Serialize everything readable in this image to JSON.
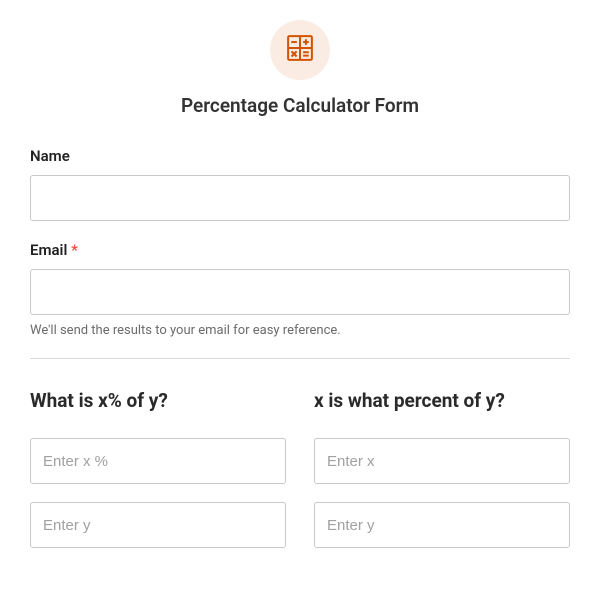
{
  "header": {
    "title": "Percentage Calculator Form",
    "icon": "calculator-icon"
  },
  "fields": {
    "name": {
      "label": "Name",
      "required": false
    },
    "email": {
      "label": "Email",
      "required": true,
      "required_mark": "*",
      "helper": "We'll send the results to your email for easy reference."
    }
  },
  "calculators": {
    "percent_of": {
      "title": "What is x% of y?",
      "x_placeholder": "Enter x %",
      "y_placeholder": "Enter y"
    },
    "what_percent": {
      "title": "x is what percent of y?",
      "x_placeholder": "Enter x",
      "y_placeholder": "Enter y"
    }
  }
}
